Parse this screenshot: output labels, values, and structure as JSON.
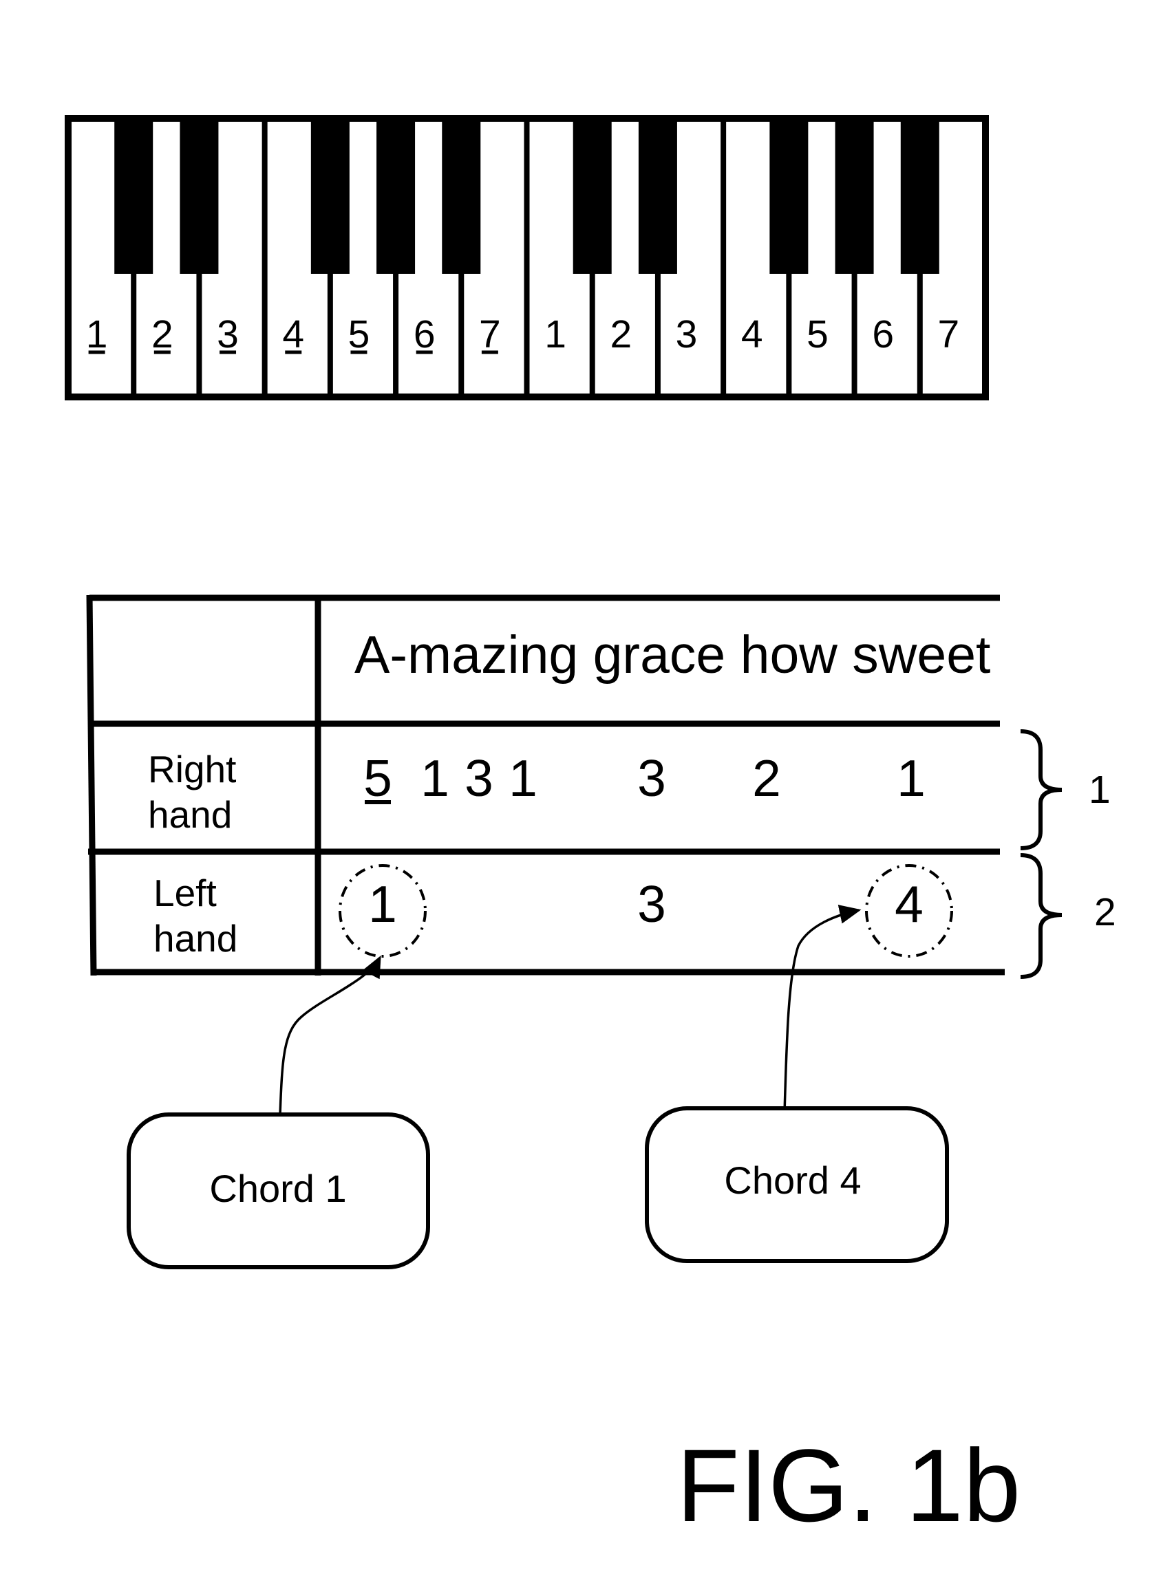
{
  "figure_label": "FIG. 1b",
  "keyboard": {
    "white_keys": [
      {
        "label": "1",
        "underlined": true
      },
      {
        "label": "2",
        "underlined": true
      },
      {
        "label": "3",
        "underlined": true
      },
      {
        "label": "4",
        "underlined": true
      },
      {
        "label": "5",
        "underlined": true
      },
      {
        "label": "6",
        "underlined": true
      },
      {
        "label": "7",
        "underlined": true
      },
      {
        "label": "1",
        "underlined": false
      },
      {
        "label": "2",
        "underlined": false
      },
      {
        "label": "3",
        "underlined": false
      },
      {
        "label": "4",
        "underlined": false
      },
      {
        "label": "5",
        "underlined": false
      },
      {
        "label": "6",
        "underlined": false
      },
      {
        "label": "7",
        "underlined": false
      }
    ],
    "black_keys_after_white_index": [
      0,
      1,
      3,
      4,
      5,
      7,
      8,
      10,
      11,
      12
    ]
  },
  "table": {
    "lyrics": "A-mazing grace how sweet",
    "rows": [
      {
        "label_line1": "Right",
        "label_line2": "hand",
        "notes": [
          {
            "value": "5",
            "underlined": true,
            "circled": false
          },
          {
            "value": "1",
            "underlined": false,
            "circled": false
          },
          {
            "value": "3",
            "underlined": false,
            "circled": false
          },
          {
            "value": "1",
            "underlined": false,
            "circled": false
          },
          {
            "value": "3",
            "underlined": false,
            "circled": false
          },
          {
            "value": "2",
            "underlined": false,
            "circled": false
          },
          {
            "value": "1",
            "underlined": false,
            "circled": false
          }
        ],
        "brace_label": "1"
      },
      {
        "label_line1": "Left",
        "label_line2": "hand",
        "notes": [
          {
            "value": "1",
            "underlined": false,
            "circled": true
          },
          {
            "value": "3",
            "underlined": false,
            "circled": false
          },
          {
            "value": "4",
            "underlined": false,
            "circled": true
          }
        ],
        "brace_label": "2"
      }
    ]
  },
  "callouts": [
    {
      "label": "Chord 1",
      "points_to": "left-hand note 1"
    },
    {
      "label": "Chord 4",
      "points_to": "left-hand note 4"
    }
  ]
}
